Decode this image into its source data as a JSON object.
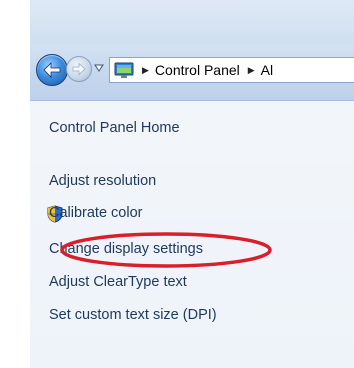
{
  "address_bar": {
    "crumbs": [
      "Control Panel",
      "Al"
    ]
  },
  "sidebar": {
    "items": [
      {
        "label": "Control Panel Home"
      },
      {
        "label": "Adjust resolution"
      },
      {
        "label": "Calibrate color"
      },
      {
        "label": "Change display settings"
      },
      {
        "label": "Adjust ClearType text"
      },
      {
        "label": "Set custom text size (DPI)"
      }
    ]
  },
  "colors": {
    "link_text": "#1e395b",
    "highlight": "#d81f2a",
    "sidebar_bg": "#eef3f9"
  },
  "icons": [
    "back-arrow-icon",
    "forward-arrow-icon",
    "dropdown-arrow-icon",
    "control-panel-icon",
    "uac-shield-icon"
  ]
}
